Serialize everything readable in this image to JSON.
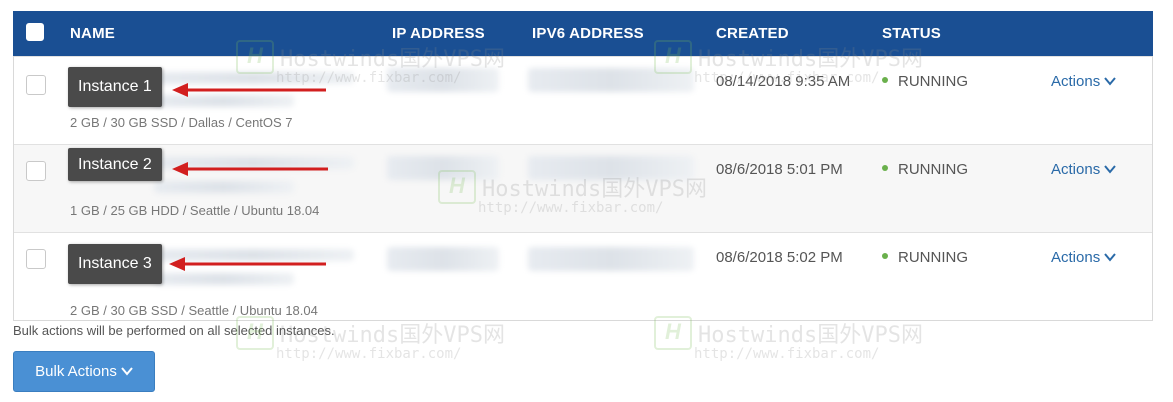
{
  "table": {
    "headers": {
      "name": "NAME",
      "ip": "IP ADDRESS",
      "ipv6": "IPV6 ADDRESS",
      "created": "CREATED",
      "status": "STATUS"
    },
    "rows": [
      {
        "label": "Instance 1",
        "specs": "2 GB / 30 GB SSD / Dallas / CentOS 7",
        "created": "08/14/2018 9:35 AM",
        "status": "RUNNING",
        "actions": "Actions"
      },
      {
        "label": "Instance 2",
        "specs": "1 GB / 25 GB HDD / Seattle / Ubuntu 18.04",
        "created": "08/6/2018 5:01 PM",
        "status": "RUNNING",
        "actions": "Actions"
      },
      {
        "label": "Instance 3",
        "specs": "2 GB / 30 GB SSD / Seattle / Ubuntu 18.04",
        "created": "08/6/2018 5:02 PM",
        "status": "RUNNING",
        "actions": "Actions"
      }
    ]
  },
  "bulk": {
    "note": "Bulk actions will be performed on all selected instances.",
    "button_label": "Bulk Actions"
  },
  "watermark": {
    "logo": "H",
    "text": "Hostwinds国外VPS网",
    "url": "http://www.fixbar.com/"
  },
  "colors": {
    "header_bg": "#1a4f93",
    "status_running": "#6ab04c",
    "link": "#2a6aa8",
    "button": "#4a90d4",
    "arrow": "#d21f1f"
  },
  "icons": {
    "chevron": "chevron-down-icon",
    "status_dot": "status-dot-icon",
    "arrow": "red-arrow-icon"
  }
}
